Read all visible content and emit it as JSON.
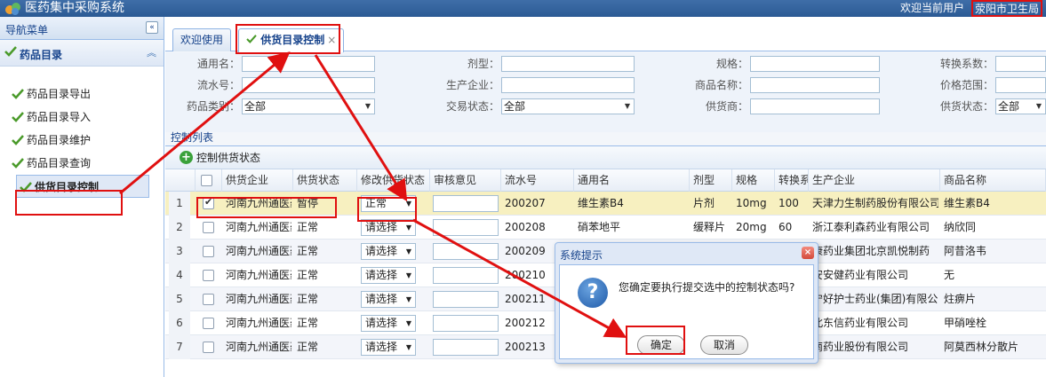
{
  "app": {
    "title": "医药集中采购系统",
    "welcome": "欢迎当前用户",
    "user": "荥阳市卫生局"
  },
  "sidebar": {
    "header": "导航菜单",
    "collapse_icon": "«",
    "group": "药品目录",
    "group_arrow": "≈",
    "items": [
      {
        "label": "药品目录导出"
      },
      {
        "label": "药品目录导入"
      },
      {
        "label": "药品目录维护"
      },
      {
        "label": "药品目录查询"
      },
      {
        "label": "供货目录控制"
      }
    ]
  },
  "tabs": [
    {
      "label": "欢迎使用"
    },
    {
      "label": "供货目录控制",
      "close": "×"
    }
  ],
  "form": {
    "row1": [
      "通用名：",
      "剂型：",
      "规格：",
      "转换系数："
    ],
    "row2": [
      "流水号：",
      "生产企业：",
      "商品名称：",
      "价格范围："
    ],
    "row3": [
      "药品类别：",
      "交易状态：",
      "供货商：",
      "供货状态："
    ],
    "select_all": "全部"
  },
  "list": {
    "title": "控制列表",
    "tool_button": "控制供货状态",
    "columns": [
      "供货企业",
      "供货状态",
      "修改供货状态",
      "审核意见",
      "流水号",
      "通用名",
      "剂型",
      "规格",
      "转换系数",
      "生产企业",
      "商品名称"
    ],
    "rows": [
      {
        "num": "1",
        "checked": true,
        "supplier": "河南九州通医药",
        "status": "暂停",
        "modify": "正常",
        "serial": "200207",
        "name": "维生素B4",
        "form": "片剂",
        "spec": "10mg",
        "factor": "100",
        "maker": "天津力生制药股份有限公司",
        "product": "维生素B4"
      },
      {
        "num": "2",
        "checked": false,
        "supplier": "河南九州通医药",
        "status": "正常",
        "modify": "请选择",
        "serial": "200208",
        "name": "硝苯地平",
        "form": "缓释片",
        "spec": "20mg",
        "factor": "60",
        "maker": "浙江泰利森药业有限公司",
        "product": "纳欣同"
      },
      {
        "num": "3",
        "checked": false,
        "supplier": "河南九州通医药",
        "status": "正常",
        "modify": "请选择",
        "serial": "200209",
        "name": "",
        "form": "",
        "spec": "",
        "factor": "",
        "maker": "康药业集团北京凯悦制药",
        "product": "阿昔洛韦"
      },
      {
        "num": "4",
        "checked": false,
        "supplier": "河南九州通医药",
        "status": "正常",
        "modify": "请选择",
        "serial": "200210",
        "name": "",
        "form": "",
        "spec": "",
        "factor": "",
        "maker": "安安健药业有限公司",
        "product": "无"
      },
      {
        "num": "5",
        "checked": false,
        "supplier": "河南九州通医药",
        "status": "正常",
        "modify": "请选择",
        "serial": "200211",
        "name": "",
        "form": "",
        "spec": "",
        "factor": "",
        "maker": "宁好护士药业(集团)有限公",
        "product": "炷痹片"
      },
      {
        "num": "6",
        "checked": false,
        "supplier": "河南九州通医药",
        "status": "正常",
        "modify": "请选择",
        "serial": "200212",
        "name": "",
        "form": "",
        "spec": "",
        "factor": "",
        "maker": "北东信药业有限公司",
        "product": "甲硝唑栓"
      },
      {
        "num": "7",
        "checked": false,
        "supplier": "河南九州通医药",
        "status": "正常",
        "modify": "请选择",
        "serial": "200213",
        "name": "",
        "form": "",
        "spec": "",
        "factor": "",
        "maker": "南药业股份有限公司",
        "product": "阿莫西林分散片"
      }
    ]
  },
  "dialog": {
    "title": "系统提示",
    "close": "×",
    "icon": "?",
    "message": "您确定要执行提交选中的控制状态吗?",
    "ok": "确定",
    "cancel": "取消"
  },
  "colors": {
    "header_bg": "#2b5a94",
    "annotation_red": "#e01010",
    "selected_row": "#f7f0c0"
  }
}
